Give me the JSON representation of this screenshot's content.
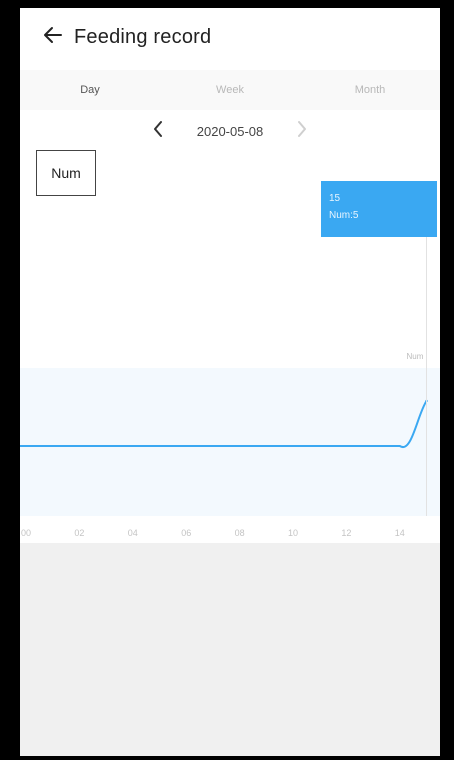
{
  "header": {
    "title": "Feeding record",
    "back_icon": "arrow-left-icon"
  },
  "tabs": [
    {
      "label": "Day",
      "active": true
    },
    {
      "label": "Week",
      "active": false
    },
    {
      "label": "Month",
      "active": false
    }
  ],
  "date_nav": {
    "date": "2020-05-08",
    "prev_icon": "chevron-left-icon",
    "next_icon": "chevron-right-icon"
  },
  "legend": {
    "label": "Num"
  },
  "tooltip": {
    "line1": "15",
    "line2": "Num:5"
  },
  "chart_data": {
    "type": "line",
    "x": [
      0,
      1,
      2,
      3,
      4,
      5,
      6,
      7,
      8,
      9,
      10,
      11,
      12,
      13,
      14,
      15
    ],
    "series": [
      {
        "values": [
          0,
          0,
          0,
          0,
          0,
          0,
          0,
          0,
          0,
          0,
          0,
          0,
          0,
          0,
          0,
          5
        ]
      }
    ],
    "x_tick_labels": [
      "00",
      "02",
      "04",
      "06",
      "08",
      "10",
      "12",
      "14"
    ],
    "peak_label": "Num",
    "line_color": "#3aa8f2",
    "area_color": "#f3f9fe"
  },
  "colors": {
    "accent": "#3aa8f2",
    "tooltip_bg": "#3aa8f2"
  }
}
